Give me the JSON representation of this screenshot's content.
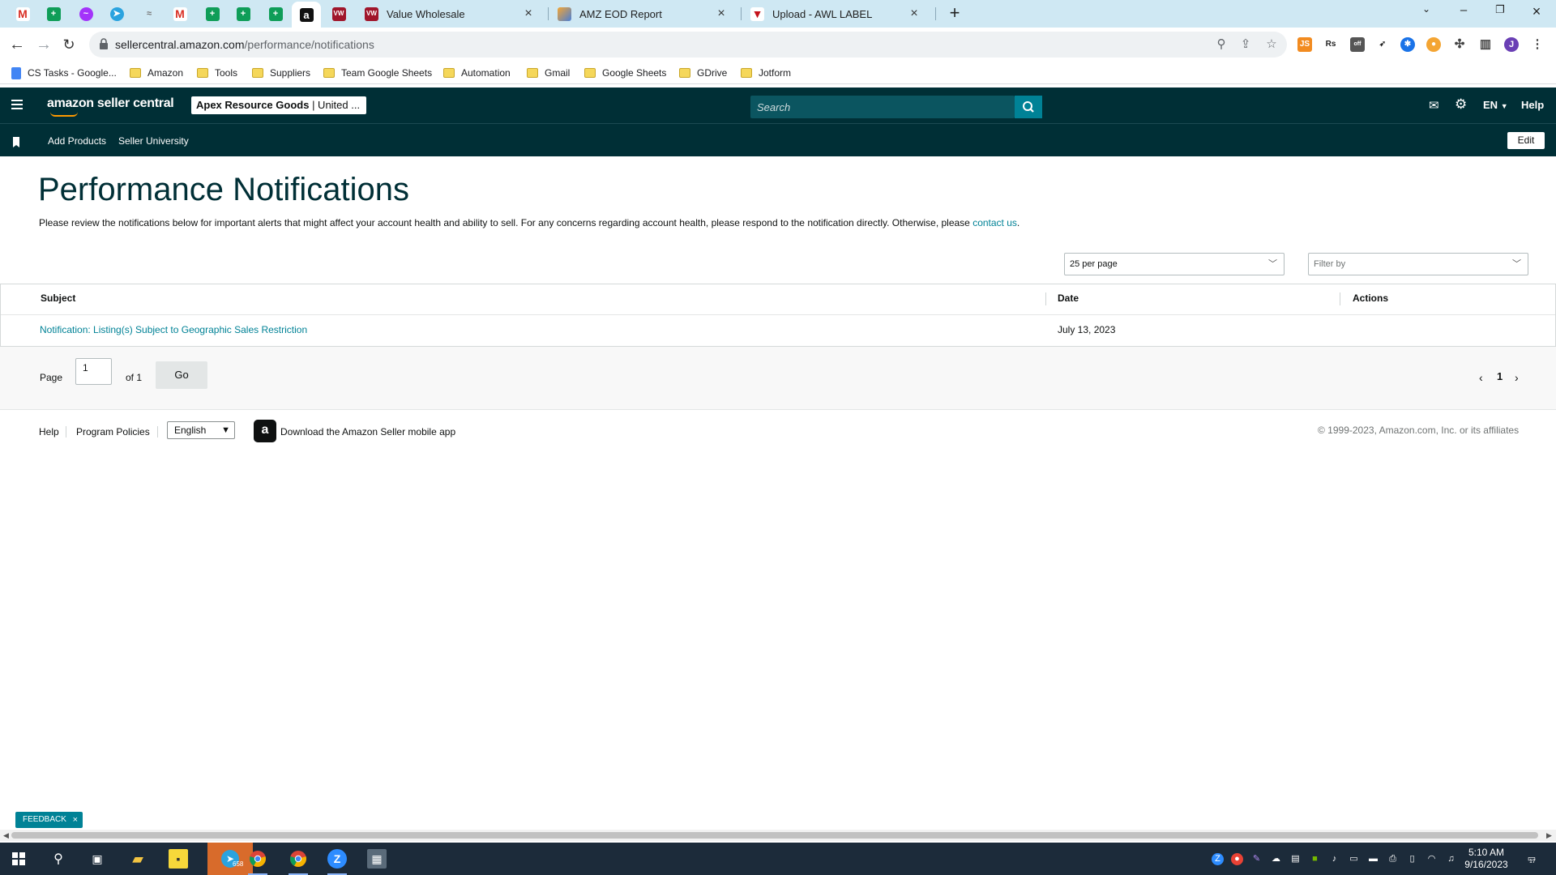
{
  "browser": {
    "tabs": [
      {
        "title": "Value Wholesale",
        "favicon": "vw-icon"
      },
      {
        "title": "AMZ EOD Report",
        "favicon": "chart-icon"
      },
      {
        "title": "Upload - AWL LABEL",
        "favicon": "awl-icon"
      }
    ],
    "pinned_tabs": [
      "gmail-icon",
      "sheets-icon",
      "messenger-icon",
      "telegram-icon",
      "signature-icon",
      "gmail-icon",
      "sheets-icon",
      "sheets-icon",
      "sheets-icon",
      "amazon-icon",
      "vw-icon"
    ],
    "url_host": "sellercentral.amazon.com",
    "url_path": "/performance/notifications",
    "bookmarks": [
      "CS Tasks - Google...",
      "Amazon",
      "Tools",
      "Suppliers",
      "Team Google Sheets",
      "Automation",
      "Gmail",
      "Google Sheets",
      "GDrive",
      "Jotform"
    ],
    "profile_initial": "J"
  },
  "header": {
    "logo_text": "amazon seller central",
    "account_name": "Apex Resource Goods",
    "account_region": "| United ...",
    "search_placeholder": "Search",
    "language": "EN",
    "help": "Help",
    "subnav": [
      "Add Products",
      "Seller University"
    ],
    "edit": "Edit"
  },
  "main": {
    "title": "Performance Notifications",
    "intro": "Please review the notifications below for important alerts that might affect your account health and ability to sell. For any concerns regarding account health, please respond to the notification directly. Otherwise, please",
    "contact_link": "contact us",
    "per_page": "25 per page",
    "filter_placeholder": "Filter by",
    "columns": [
      "Subject",
      "Date",
      "Actions"
    ],
    "rows": [
      {
        "subject": "Notification: Listing(s) Subject to Geographic Sales Restriction",
        "date": "July 13, 2023",
        "actions": ""
      }
    ],
    "pager": {
      "page_label": "Page",
      "page_value": "1",
      "of_label": "of 1",
      "go": "Go",
      "current": "1"
    }
  },
  "footer": {
    "help": "Help",
    "policies": "Program Policies",
    "language": "English",
    "app_text": "Download the Amazon Seller mobile app",
    "copyright": "© 1999-2023, Amazon.com, Inc. or its affiliates"
  },
  "feedback": "FEEDBACK",
  "taskbar": {
    "time": "5:10 AM",
    "date": "9/16/2023",
    "telegram_badge": "658",
    "notif_count": "17"
  },
  "colors": {
    "brand_dark": "#002f36",
    "accent_teal": "#008296",
    "link": "#008296"
  }
}
